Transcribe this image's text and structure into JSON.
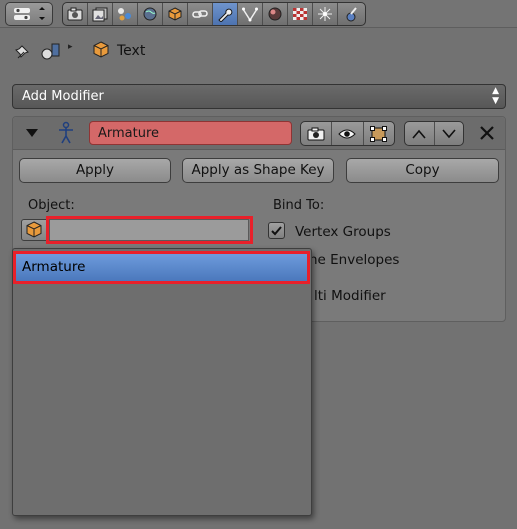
{
  "header": {
    "editor_icon": "properties-editor-icon",
    "tabs": [
      {
        "icon": "render-icon"
      },
      {
        "icon": "render-layers-icon"
      },
      {
        "icon": "scene-icon"
      },
      {
        "icon": "world-icon"
      },
      {
        "icon": "object-icon"
      },
      {
        "icon": "constraints-icon"
      },
      {
        "icon": "modifiers-wrench-icon",
        "active": true
      },
      {
        "icon": "data-icon"
      },
      {
        "icon": "material-icon"
      },
      {
        "icon": "texture-icon"
      },
      {
        "icon": "particles-icon"
      },
      {
        "icon": "physics-icon"
      }
    ]
  },
  "breadcrumb": {
    "object_name": "Text"
  },
  "add_modifier": {
    "label": "Add Modifier"
  },
  "modifier": {
    "name": "Armature",
    "apply_label": "Apply",
    "apply_shape_label": "Apply as Shape Key",
    "copy_label": "Copy",
    "object_label": "Object:",
    "object_value": "",
    "bind_to_label": "Bind To:",
    "vertex_groups_label": "Vertex Groups",
    "vertex_groups_checked": true,
    "bone_envelopes_label": "ne Envelopes",
    "multi_modifier_label": "lti Modifier"
  },
  "dropdown": {
    "items": [
      "Armature"
    ]
  },
  "colors": {
    "highlight": "#e8202a",
    "selection": "#5680c4",
    "name_field": "#d46868"
  }
}
